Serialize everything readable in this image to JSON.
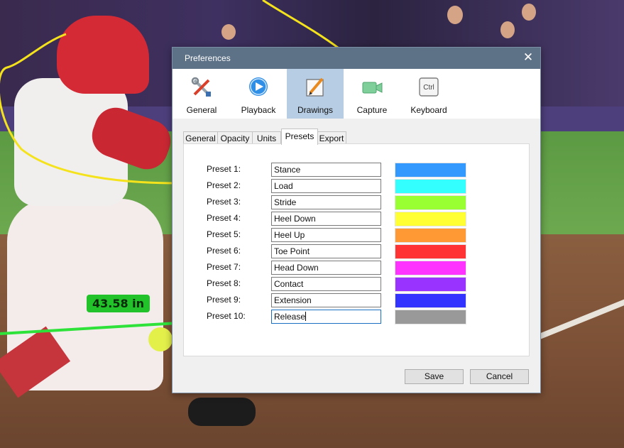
{
  "overlay": {
    "measurement": "43.58 in"
  },
  "dialog": {
    "title": "Preferences",
    "close_glyph": "✕",
    "categories": [
      {
        "label": "General",
        "icon": "tools-icon"
      },
      {
        "label": "Playback",
        "icon": "play-icon"
      },
      {
        "label": "Drawings",
        "icon": "pencil-icon",
        "active": true
      },
      {
        "label": "Capture",
        "icon": "camera-icon"
      },
      {
        "label": "Keyboard",
        "icon": "keyboard-icon",
        "key_text": "Ctrl"
      }
    ],
    "tabs": [
      {
        "label": "General"
      },
      {
        "label": "Opacity"
      },
      {
        "label": "Units"
      },
      {
        "label": "Presets",
        "active": true
      },
      {
        "label": "Export"
      }
    ],
    "presets": [
      {
        "label": "Preset 1:",
        "value": "Stance",
        "color": "#3399ff"
      },
      {
        "label": "Preset 2:",
        "value": "Load",
        "color": "#33ffff"
      },
      {
        "label": "Preset 3:",
        "value": "Stride",
        "color": "#99ff33"
      },
      {
        "label": "Preset 4:",
        "value": "Heel Down",
        "color": "#ffff33"
      },
      {
        "label": "Preset 5:",
        "value": "Heel Up",
        "color": "#ff9933"
      },
      {
        "label": "Preset 6:",
        "value": "Toe Point",
        "color": "#ff3333"
      },
      {
        "label": "Preset 7:",
        "value": "Head Down",
        "color": "#ff33ff"
      },
      {
        "label": "Preset 8:",
        "value": "Contact",
        "color": "#9933ff"
      },
      {
        "label": "Preset 9:",
        "value": "Extension",
        "color": "#3333ff"
      },
      {
        "label": "Preset 10:",
        "value": "Release",
        "color": "#999999"
      }
    ],
    "buttons": {
      "save": "Save",
      "cancel": "Cancel"
    }
  }
}
